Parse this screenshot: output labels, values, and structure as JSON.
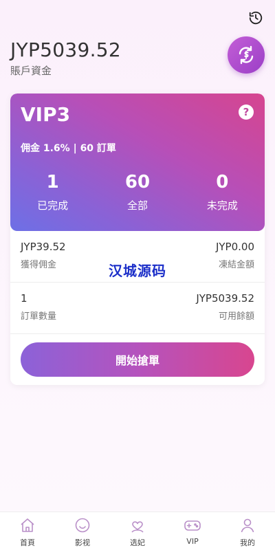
{
  "header": {
    "balance": "JYP5039.52",
    "balance_label": "賬戶資金"
  },
  "vip": {
    "level": "VIP3",
    "commission_text": "佣金 1.6% | 60 訂單",
    "stats": [
      {
        "value": "1",
        "label": "已完成"
      },
      {
        "value": "60",
        "label": "全部"
      },
      {
        "value": "0",
        "label": "未完成"
      }
    ]
  },
  "info": {
    "earned_value": "JYP39.52",
    "earned_label": "獲得佣金",
    "frozen_value": "JYP0.00",
    "frozen_label": "凍結金額",
    "orders_value": "1",
    "orders_label": "訂單數量",
    "available_value": "JYP5039.52",
    "available_label": "可用餘額"
  },
  "watermark": "汉城源码",
  "actions": {
    "grab_label": "開始搶單"
  },
  "tabbar": [
    {
      "label": "首頁",
      "icon": "home-icon"
    },
    {
      "label": "影视",
      "icon": "smile-icon"
    },
    {
      "label": "选妃",
      "icon": "heart-person-icon"
    },
    {
      "label": "VIP",
      "icon": "gamepad-icon"
    },
    {
      "label": "我的",
      "icon": "user-icon"
    }
  ],
  "colors": {
    "accent": "#b553bd",
    "gradient_start": "#6d70e6",
    "gradient_end": "#d6458f",
    "watermark": "#1c2fc9"
  }
}
